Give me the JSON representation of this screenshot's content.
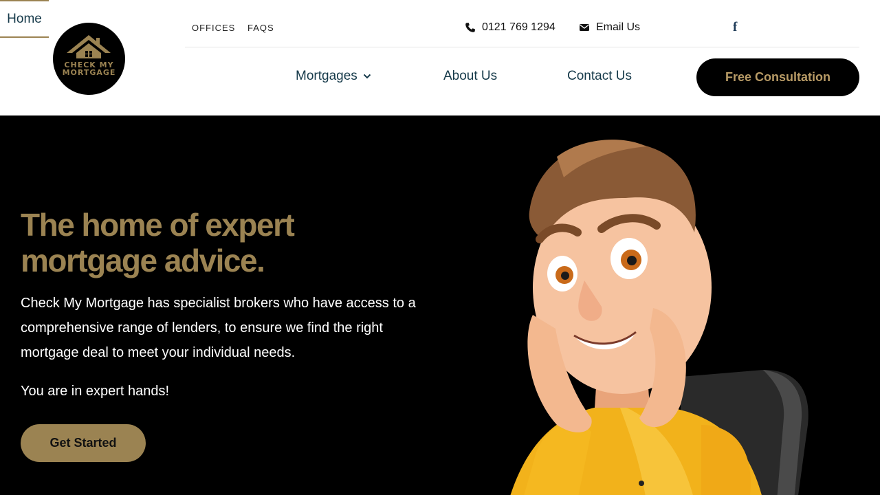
{
  "brand": {
    "logo_line1": "CHECK MY",
    "logo_line2": "MORTGAGE",
    "gold": "#9b8352",
    "navy": "#163a4a"
  },
  "topbar": {
    "offices_label": "OFFICES",
    "faqs_label": "FAQS",
    "phone": "0121 769 1294",
    "phone_icon": "phone-icon",
    "email_label": "Email Us",
    "email_icon": "envelope-icon",
    "facebook_icon": "facebook-icon",
    "facebook_glyph": "f"
  },
  "nav": {
    "home": "Home",
    "mortgages": "Mortgages",
    "about": "About Us",
    "contact": "Contact Us",
    "consult": "Free Consultation"
  },
  "hero": {
    "title": "The home of expert mortgage advice.",
    "body": "Check My Mortgage has specialist brokers who have access to a comprehensive range of lenders, to ensure we find the right mortgage deal to meet your individual needs.",
    "sub": "You are in expert hands!",
    "cta": "Get Started"
  }
}
